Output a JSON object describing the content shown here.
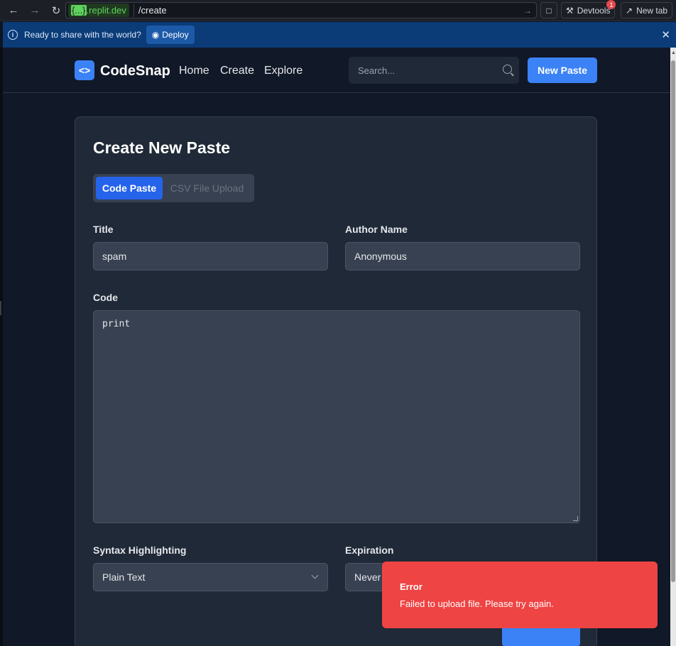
{
  "browser": {
    "url_host": ".replit.dev",
    "url_host_brace": "{...}",
    "url_path": "/create",
    "devtools_label": "Devtools",
    "devtools_badge": "1",
    "new_tab_label": "New tab"
  },
  "deploy_bar": {
    "message": "Ready to share with the world?",
    "button_label": "Deploy"
  },
  "header": {
    "logo_glyph": "<>",
    "brand": "CodeSnap",
    "nav": [
      "Home",
      "Create",
      "Explore"
    ],
    "search_placeholder": "Search...",
    "new_paste_label": "New Paste"
  },
  "form": {
    "title": "Create New Paste",
    "tabs": [
      "Code Paste",
      "CSV File Upload"
    ],
    "active_tab": "Code Paste",
    "title_label": "Title",
    "title_value": "spam",
    "author_label": "Author Name",
    "author_value": "Anonymous",
    "code_label": "Code",
    "code_value": "print",
    "syntax_label": "Syntax Highlighting",
    "syntax_value": "Plain Text",
    "expiration_label": "Expiration",
    "expiration_value": "Never"
  },
  "toast": {
    "title": "Error",
    "message": "Failed to upload file. Please try again.",
    "color": "#ef4444"
  },
  "colors": {
    "accent": "#3b82f6",
    "background": "#111827",
    "card": "#1f2937"
  }
}
